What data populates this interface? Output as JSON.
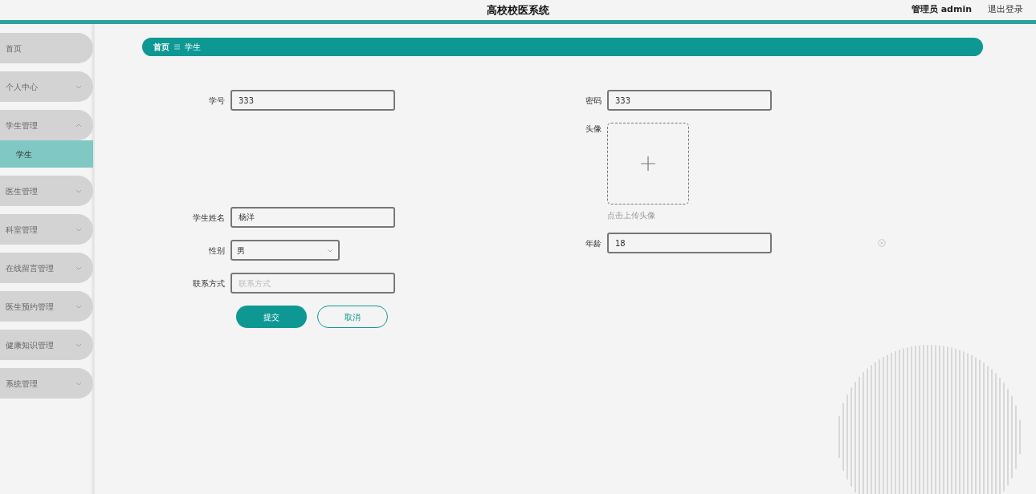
{
  "header": {
    "title": "高校校医系统",
    "user": "管理员 admin",
    "logout": "退出登录"
  },
  "sidebar": {
    "items": [
      {
        "label": "首页",
        "kind": "link",
        "selected": false
      },
      {
        "label": "个人中心",
        "kind": "group",
        "expanded": false
      },
      {
        "label": "学生管理",
        "kind": "group",
        "expanded": true,
        "children": [
          {
            "label": "学生",
            "selected": true
          }
        ]
      },
      {
        "label": "医生管理",
        "kind": "group",
        "expanded": false
      },
      {
        "label": "科室管理",
        "kind": "group",
        "expanded": false
      },
      {
        "label": "在线留言管理",
        "kind": "group",
        "expanded": false
      },
      {
        "label": "医生预约管理",
        "kind": "group",
        "expanded": false
      },
      {
        "label": "健康知识管理",
        "kind": "group",
        "expanded": false
      },
      {
        "label": "系统管理",
        "kind": "group",
        "expanded": false
      }
    ]
  },
  "breadcrumb": [
    "首页",
    "学生"
  ],
  "form": {
    "left_fields": [
      {
        "label": "学号",
        "kind": "input",
        "value": "333"
      },
      {
        "label": "学生姓名",
        "kind": "input",
        "value": "杨洋"
      },
      {
        "label": "性别",
        "kind": "select",
        "value": "男"
      },
      {
        "label": "联系方式",
        "kind": "input",
        "placeholder": "联系方式"
      }
    ],
    "right_fields": [
      {
        "label": "密码",
        "kind": "input",
        "value": "333"
      },
      {
        "label": "头像",
        "kind": "upload",
        "hint": "点击上传头像"
      },
      {
        "label": "年龄",
        "kind": "input",
        "value": "18",
        "clearable": true
      }
    ],
    "buttons": [
      {
        "label": "提交",
        "kind": "primary"
      },
      {
        "label": "取消",
        "kind": "secondary"
      }
    ]
  }
}
